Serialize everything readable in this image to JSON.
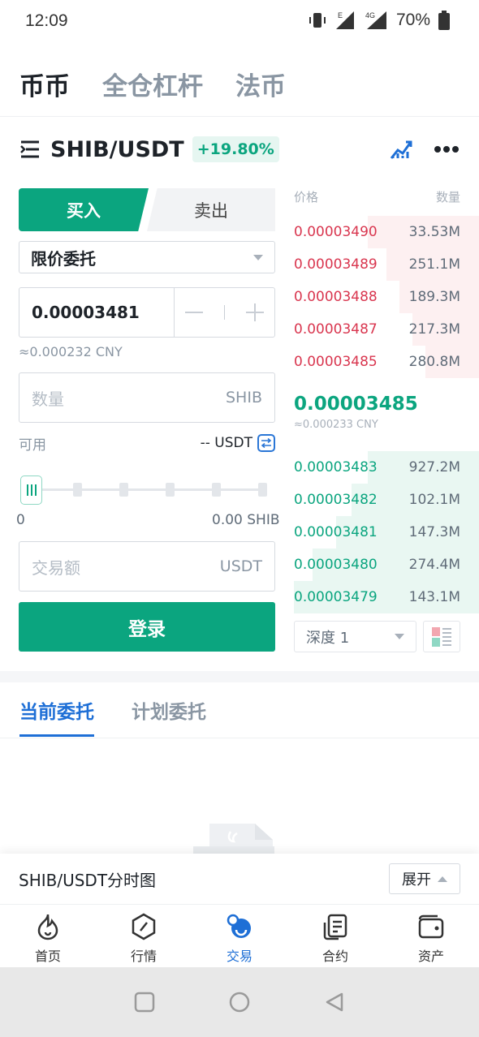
{
  "status_bar": {
    "time": "12:09",
    "battery": "70%",
    "net_e": "E",
    "net_4g": "4G"
  },
  "top_tabs": [
    "币币",
    "全仓杠杆",
    "法币"
  ],
  "pair": {
    "name": "SHIB/USDT",
    "change": "+19.80%"
  },
  "trade": {
    "buy_label": "买入",
    "sell_label": "卖出",
    "order_type": "限价委托",
    "price": "0.00003481",
    "price_cny": "≈0.000232 CNY",
    "amount_placeholder": "数量",
    "amount_unit": "SHIB",
    "available_label": "可用",
    "available_value": "-- USDT",
    "slider_min": "0",
    "slider_max": "0.00 SHIB",
    "total_placeholder": "交易额",
    "total_unit": "USDT",
    "login_label": "登录"
  },
  "order_book": {
    "price_header": "价格",
    "qty_header": "数量",
    "asks": [
      {
        "price": "0.00003490",
        "qty": "33.53M",
        "depth": 0.6
      },
      {
        "price": "0.00003489",
        "qty": "251.1M",
        "depth": 0.5
      },
      {
        "price": "0.00003488",
        "qty": "189.3M",
        "depth": 0.43
      },
      {
        "price": "0.00003487",
        "qty": "217.3M",
        "depth": 0.36
      },
      {
        "price": "0.00003485",
        "qty": "280.8M",
        "depth": 0.29
      }
    ],
    "last_price": "0.00003485",
    "last_price_cny": "≈0.000233 CNY",
    "bids": [
      {
        "price": "0.00003483",
        "qty": "927.2M",
        "depth": 0.6
      },
      {
        "price": "0.00003482",
        "qty": "102.1M",
        "depth": 0.69
      },
      {
        "price": "0.00003481",
        "qty": "147.3M",
        "depth": 0.77
      },
      {
        "price": "0.00003480",
        "qty": "274.4M",
        "depth": 0.9
      },
      {
        "price": "0.00003479",
        "qty": "143.1M",
        "depth": 1.0
      }
    ],
    "depth_label": "深度 1"
  },
  "order_tabs": [
    "当前委托",
    "计划委托"
  ],
  "chart_bar": {
    "title": "SHIB/USDT分时图",
    "expand_label": "展开"
  },
  "bottom_nav": [
    {
      "label": "首页",
      "icon": "flame-icon"
    },
    {
      "label": "行情",
      "icon": "compass-icon"
    },
    {
      "label": "交易",
      "icon": "exchange-icon"
    },
    {
      "label": "合约",
      "icon": "contract-icon"
    },
    {
      "label": "资产",
      "icon": "wallet-icon"
    }
  ],
  "colors": {
    "green": "#0ba57f",
    "red": "#d9364f",
    "blue": "#1e6fd6"
  }
}
